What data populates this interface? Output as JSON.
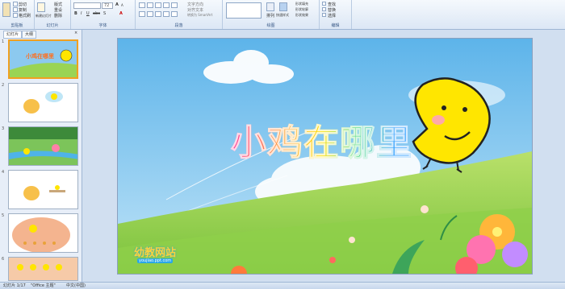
{
  "ribbon": {
    "groups": [
      {
        "label": "剪贴板"
      },
      {
        "label": "幻灯片"
      },
      {
        "label": "字体"
      },
      {
        "label": "段落"
      },
      {
        "label": "绘图"
      },
      {
        "label": "编辑"
      }
    ],
    "clipboard": {
      "cut": "剪切",
      "copy": "复制",
      "format_painter": "格式刷"
    },
    "slides": {
      "layout": "版式",
      "reset": "重设",
      "new_slide": "新建幻灯片",
      "delete": "删除"
    },
    "font": {
      "size_value": "72"
    },
    "paragraph": {
      "text_direction": "文字方向",
      "align_text": "对齐文本",
      "smartart": "转换为 SmartArt"
    },
    "drawing": {
      "arrange": "排列",
      "quick_styles": "快速样式",
      "fill": "形状填充",
      "outline": "形状轮廓",
      "effects": "形状效果"
    },
    "editing": {
      "find": "查找",
      "replace": "替换",
      "select": "选择"
    }
  },
  "pane": {
    "tabs": [
      "幻灯片",
      "大纲"
    ],
    "slide_numbers": [
      "1",
      "2",
      "3",
      "4",
      "5",
      "6"
    ]
  },
  "slide": {
    "title": "小鸡在哪里",
    "watermark": "幼教网站",
    "watermark_url": "youjiao.ppt.com"
  },
  "status": {
    "slide_count": "幻灯片 1/17",
    "theme": "\"Office 主题\"",
    "language": "中文(中国)"
  },
  "colors": {
    "ribbon_bg": "#dce7f5",
    "selected_thumb": "#f0a020",
    "sky": "#7fc3ee",
    "grass": "#8fd04a",
    "chick": "#ffe500"
  }
}
